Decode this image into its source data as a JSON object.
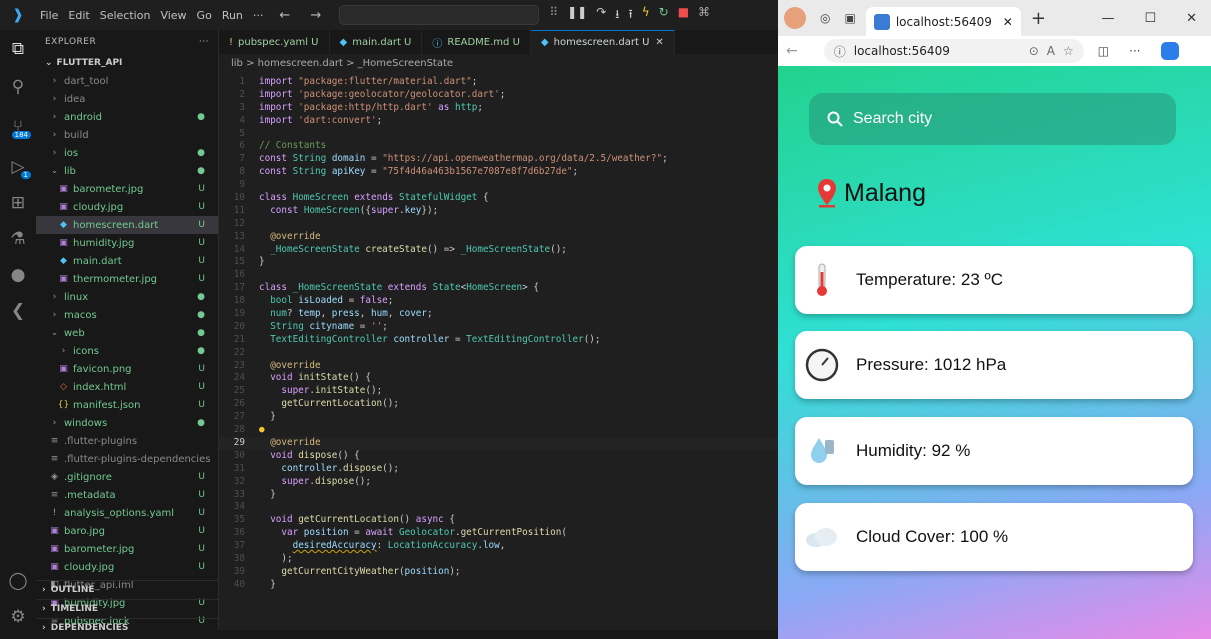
{
  "vscode": {
    "menu": [
      "File",
      "Edit",
      "Selection",
      "View",
      "Go",
      "Run",
      "···"
    ],
    "activity_badges": {
      "source_control": "184",
      "run": "1"
    },
    "explorer": {
      "title": "EXPLORER",
      "project": "FLUTTER_API",
      "items": [
        {
          "label": "dart_tool",
          "type": "folder",
          "indent": 1,
          "status": "",
          "color": "#8a8a8a"
        },
        {
          "label": "idea",
          "type": "folder",
          "indent": 1,
          "status": "",
          "color": "#8a8a8a"
        },
        {
          "label": "android",
          "type": "folder",
          "indent": 1,
          "status": "●",
          "color": "#73c991"
        },
        {
          "label": "build",
          "type": "folder",
          "indent": 1,
          "status": "",
          "color": "#8a8a8a"
        },
        {
          "label": "ios",
          "type": "folder",
          "indent": 1,
          "status": "●",
          "color": "#73c991"
        },
        {
          "label": "lib",
          "type": "folder-open",
          "indent": 1,
          "status": "●",
          "color": "#73c991"
        },
        {
          "label": "barometer.jpg",
          "type": "image",
          "indent": 2,
          "status": "U",
          "color": "#73c991"
        },
        {
          "label": "cloudy.jpg",
          "type": "image",
          "indent": 2,
          "status": "U",
          "color": "#73c991"
        },
        {
          "label": "homescreen.dart",
          "type": "dart",
          "indent": 2,
          "status": "U",
          "color": "#73c991",
          "selected": true
        },
        {
          "label": "humidity.jpg",
          "type": "image",
          "indent": 2,
          "status": "U",
          "color": "#73c991"
        },
        {
          "label": "main.dart",
          "type": "dart",
          "indent": 2,
          "status": "U",
          "color": "#73c991"
        },
        {
          "label": "thermometer.jpg",
          "type": "image",
          "indent": 2,
          "status": "U",
          "color": "#73c991"
        },
        {
          "label": "linux",
          "type": "folder",
          "indent": 1,
          "status": "●",
          "color": "#73c991"
        },
        {
          "label": "macos",
          "type": "folder",
          "indent": 1,
          "status": "●",
          "color": "#73c991"
        },
        {
          "label": "web",
          "type": "folder-open",
          "indent": 1,
          "status": "●",
          "color": "#73c991"
        },
        {
          "label": "icons",
          "type": "folder",
          "indent": 2,
          "status": "●",
          "color": "#73c991"
        },
        {
          "label": "favicon.png",
          "type": "image",
          "indent": 2,
          "status": "U",
          "color": "#73c991"
        },
        {
          "label": "index.html",
          "type": "html",
          "indent": 2,
          "status": "U",
          "color": "#73c991"
        },
        {
          "label": "manifest.json",
          "type": "json",
          "indent": 2,
          "status": "U",
          "color": "#73c991"
        },
        {
          "label": "windows",
          "type": "folder",
          "indent": 1,
          "status": "●",
          "color": "#73c991"
        },
        {
          "label": ".flutter-plugins",
          "type": "file",
          "indent": 1,
          "status": "",
          "color": "#8a8a8a"
        },
        {
          "label": ".flutter-plugins-dependencies",
          "type": "file",
          "indent": 1,
          "status": "",
          "color": "#8a8a8a"
        },
        {
          "label": ".gitignore",
          "type": "git",
          "indent": 1,
          "status": "U",
          "color": "#73c991"
        },
        {
          "label": ".metadata",
          "type": "file",
          "indent": 1,
          "status": "U",
          "color": "#73c991"
        },
        {
          "label": "analysis_options.yaml",
          "type": "yaml",
          "indent": 1,
          "status": "U",
          "color": "#73c991"
        },
        {
          "label": "baro.jpg",
          "type": "image",
          "indent": 1,
          "status": "U",
          "color": "#73c991"
        },
        {
          "label": "barometer.jpg",
          "type": "image",
          "indent": 1,
          "status": "U",
          "color": "#73c991"
        },
        {
          "label": "cloudy.jpg",
          "type": "image",
          "indent": 1,
          "status": "U",
          "color": "#73c991"
        },
        {
          "label": "flutter_api.iml",
          "type": "iml",
          "indent": 1,
          "status": "",
          "color": "#8a8a8a"
        },
        {
          "label": "humidity.jpg",
          "type": "image",
          "indent": 1,
          "status": "U",
          "color": "#73c991"
        },
        {
          "label": "pubspec.lock",
          "type": "file",
          "indent": 1,
          "status": "U",
          "color": "#73c991"
        }
      ],
      "sections": [
        "OUTLINE",
        "TIMELINE",
        "DEPENDENCIES"
      ]
    },
    "tabs": [
      {
        "label": "pubspec.yaml U",
        "icon": "!"
      },
      {
        "label": "main.dart U",
        "icon": "◆"
      },
      {
        "label": "README.md U",
        "icon": "ⓘ"
      },
      {
        "label": "homescreen.dart U",
        "icon": "◆",
        "active": true
      }
    ],
    "breadcrumb": "lib > homescreen.dart > _HomeScreenState",
    "current_line": 29
  },
  "browser": {
    "tab_title": "localhost:56409",
    "url": "localhost:56409",
    "app": {
      "search_placeholder": "Search city",
      "city": "Malang",
      "cards": [
        {
          "text": "Temperature: 23 ºC",
          "icon": "thermometer-icon"
        },
        {
          "text": "Pressure: 1012 hPa",
          "icon": "barometer-icon"
        },
        {
          "text": "Humidity: 92 %",
          "icon": "humidity-icon"
        },
        {
          "text": "Cloud Cover: 100 %",
          "icon": "cloud-icon"
        }
      ]
    }
  }
}
